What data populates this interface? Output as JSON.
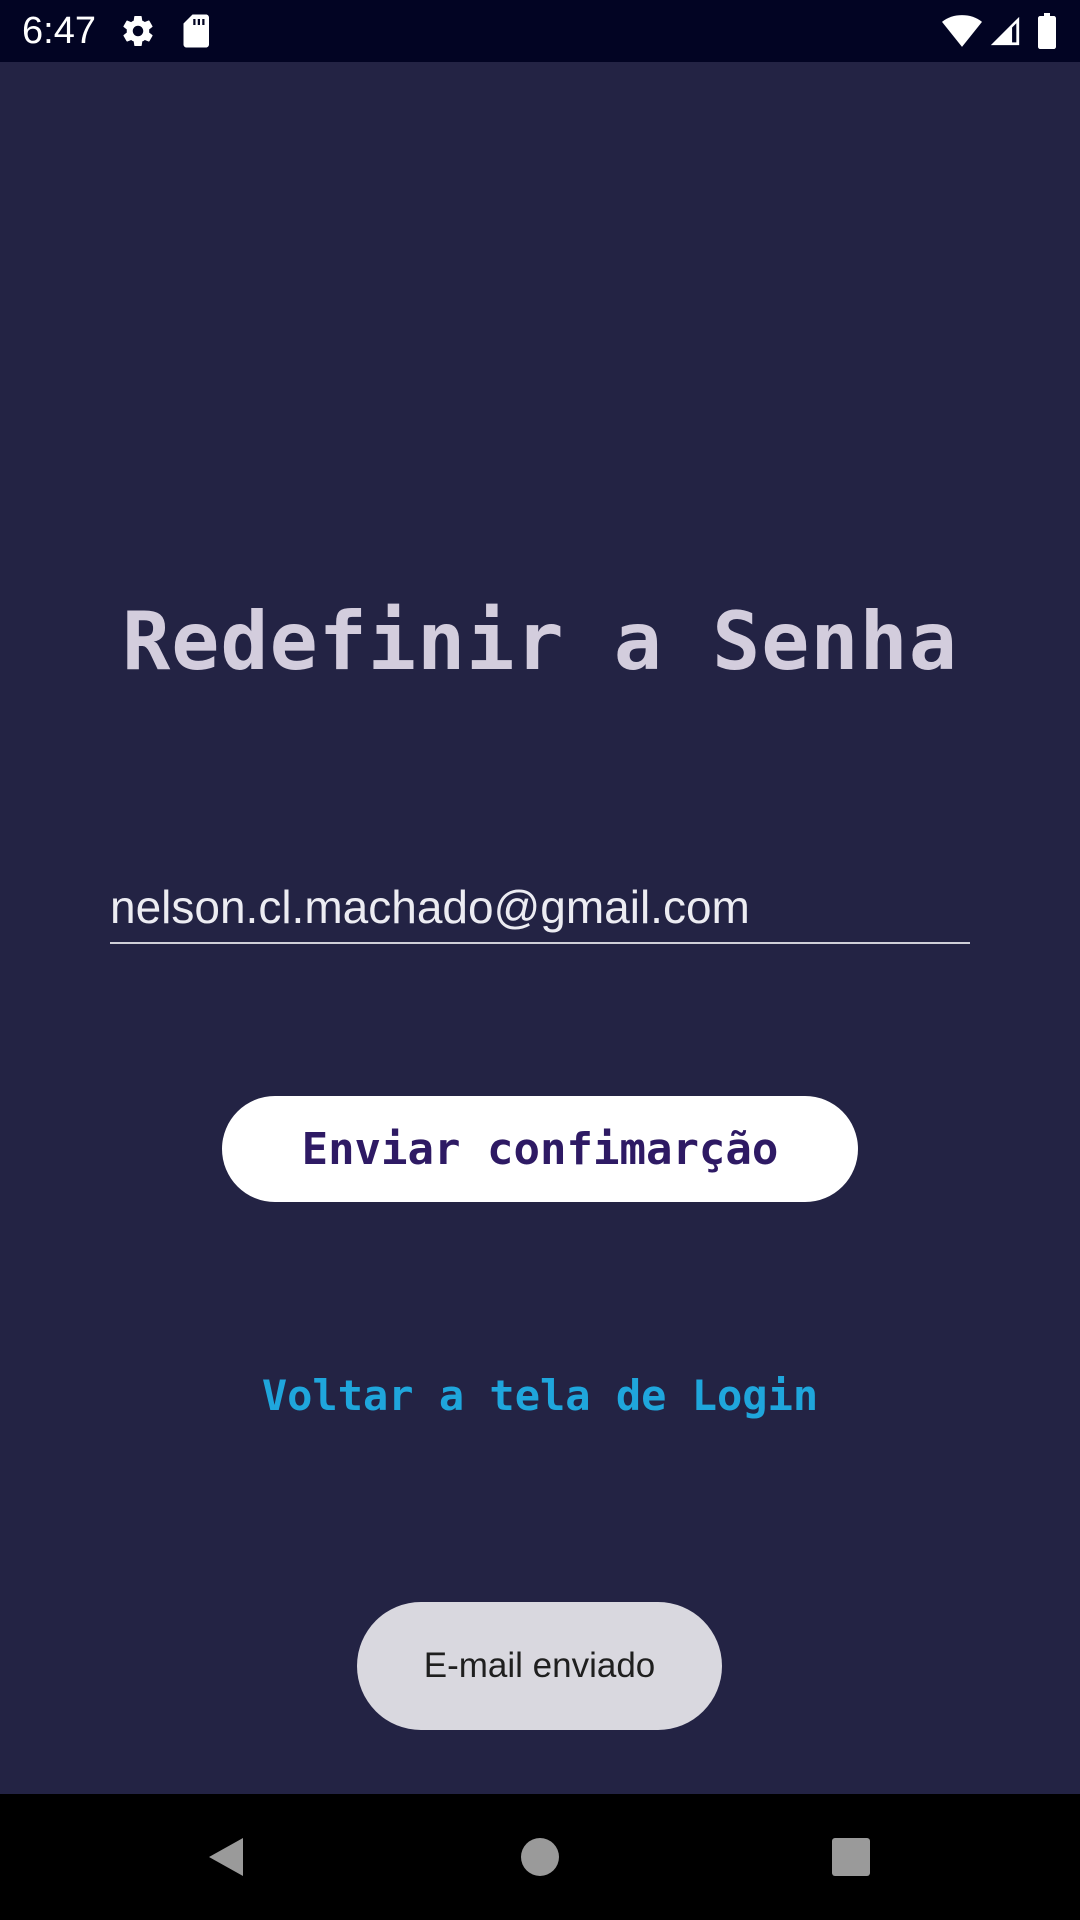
{
  "status_bar": {
    "time": "6:47",
    "icons": [
      "gear-icon",
      "sd-card-icon",
      "wifi-icon",
      "signal-icon",
      "battery-icon"
    ]
  },
  "screen": {
    "title": "Redefinir a Senha",
    "email_field": {
      "value": "nelson.cl.machado@gmail.com"
    },
    "send_button_label": "Enviar confimarção",
    "back_link_label": "Voltar a tela de Login",
    "toast_message": "E-mail enviado"
  },
  "navigation_bar": {
    "buttons": [
      "back-icon",
      "home-icon",
      "recents-icon"
    ]
  },
  "colors": {
    "background": "#232344",
    "status_bar": "#020423",
    "title": "#d3cddd",
    "button_background": "#ffffff",
    "button_text": "#2e1a64",
    "link": "#1fa6dc",
    "toast_background": "#d9d8df"
  }
}
